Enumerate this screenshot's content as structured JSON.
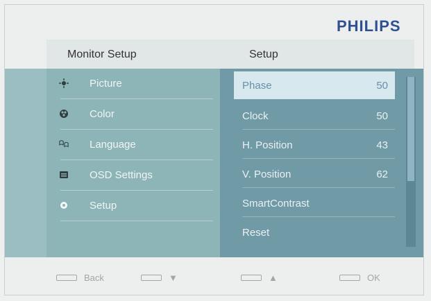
{
  "brand": "PHILIPS",
  "header": {
    "left_title": "Monitor Setup",
    "right_title": "Setup"
  },
  "left_menu": [
    {
      "label": "Picture",
      "icon": "picture-icon"
    },
    {
      "label": "Color",
      "icon": "color-icon"
    },
    {
      "label": "Language",
      "icon": "language-icon"
    },
    {
      "label": "OSD Settings",
      "icon": "osd-icon"
    },
    {
      "label": "Setup",
      "icon": "setup-icon"
    }
  ],
  "setup_rows": [
    {
      "label": "Phase",
      "value": "50",
      "selected": true
    },
    {
      "label": "Clock",
      "value": "50"
    },
    {
      "label": "H. Position",
      "value": "43"
    },
    {
      "label": "V. Position",
      "value": "62"
    },
    {
      "label": "SmartContrast",
      "value": ""
    },
    {
      "label": "Reset",
      "value": ""
    }
  ],
  "footer": {
    "back_label": "Back",
    "up_label": "▼",
    "down_label": "▲",
    "ok_label": "OK"
  },
  "colors": {
    "brand": "#2e4f91",
    "left_panel": "#8db4b7",
    "right_panel": "#6f9aa6",
    "selection": "#d7e8ee"
  }
}
